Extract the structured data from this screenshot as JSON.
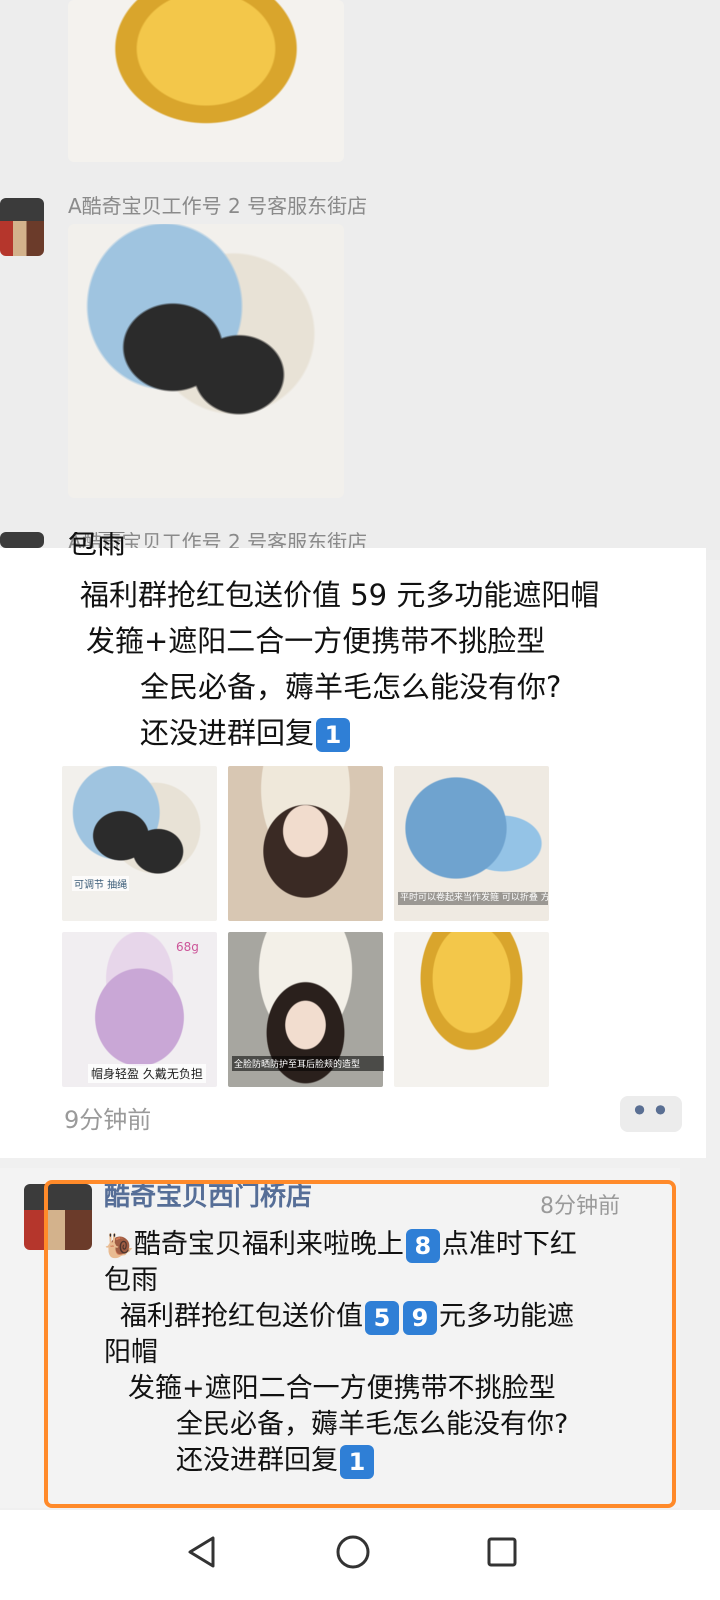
{
  "feed": {
    "sender_1": "A酷奇宝贝工作号 2 号客服东街店",
    "sender_2": "A酷奇宝贝工作号 2 号客服东街店"
  },
  "post": {
    "cut_line": "包雨",
    "line_1": "福利群抢红包送价值 59 元多功能遮阳帽",
    "line_2": "发箍+遮阳二合一方便携带不挑脸型",
    "line_3": "全民必备，薅羊毛怎么能没有你?",
    "line_4_text": "还没进群回复",
    "line_4_key": "1",
    "time": "9分钟前",
    "more": "••",
    "photo_captions": {
      "p1": "可调节 抽绳",
      "p3": "平时可以卷起来当作发箍 可以折叠 方便携带",
      "p4": "帽身轻盈 久戴无负担",
      "p4_tag": "68g",
      "p5": "全脸防晒防护至耳后脸颊的造型"
    }
  },
  "card": {
    "name": "酷奇宝贝西门桥店",
    "time": "8分钟前",
    "l1a": "酷奇宝贝福利来啦晚上",
    "l1key": "8",
    "l1b": "点准时下红",
    "l2": "包雨",
    "l3a": "福利群抢红包送价值",
    "l3k1": "5",
    "l3k2": "9",
    "l3b": "元多功能遮",
    "l4": "阳帽",
    "l5": "发箍+遮阳二合一方便携带不挑脸型",
    "l6": "全民必备，薅羊毛怎么能没有你?",
    "l7a": "还没进群回复",
    "l7key": "1"
  },
  "colors": {
    "highlight": "#ff8a2a",
    "keycap": "#2f7fd6",
    "name": "#566e97"
  },
  "icons": [
    "back-icon",
    "home-icon",
    "recents-icon",
    "snail-icon"
  ]
}
